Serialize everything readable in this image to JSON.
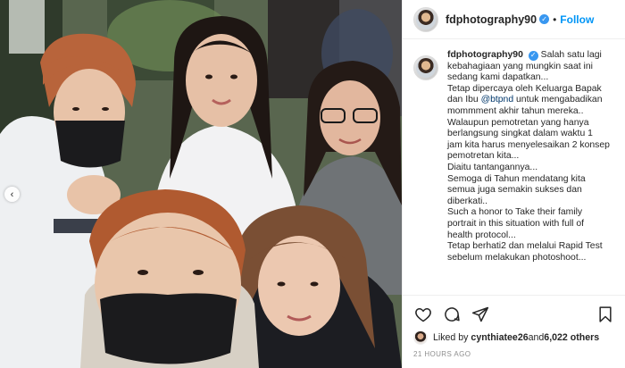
{
  "post": {
    "username": "fdphotography90",
    "follow_label": "Follow",
    "separator": "•",
    "verified_glyph": "✓"
  },
  "caption": {
    "username": "fdphotography90",
    "lines": [
      "Salah satu lagi kebahagiaan yang mungkin saat ini sedang kami dapatkan...",
      "Tetap dipercaya oleh Keluarga Bapak dan Ibu ",
      " untuk mengabadikan mommment akhir tahun mereka..",
      "Walaupun pemotretan yang hanya berlangsung singkat dalam waktu 1 jam kita harus menyelesaikan 2 konsep pemotretan kita...",
      "Diaitu tantangannya...",
      "Semoga di Tahun mendatang kita semua juga semakin sukses dan diberkati..",
      "Such a honor to Take their family portrait in this situation with full of health protocol...",
      "Tetap berhati2 dan melalui Rapid Test sebelum melakukan photoshoot..."
    ],
    "mention": "@btpnd"
  },
  "likes": {
    "prefix": "Liked by ",
    "first_user": "cynthiatee26",
    "connector": " and ",
    "others": "6,022 others"
  },
  "timestamp": "21 HOURS AGO",
  "nav": {
    "prev_glyph": "‹"
  },
  "icons": {
    "like": "heart-icon",
    "comment": "comment-icon",
    "share": "share-icon",
    "save": "bookmark-icon"
  },
  "colors": {
    "follow": "#0095f6",
    "verified": "#3897f0",
    "mention": "#00376b",
    "time": "#8e8e8e"
  }
}
